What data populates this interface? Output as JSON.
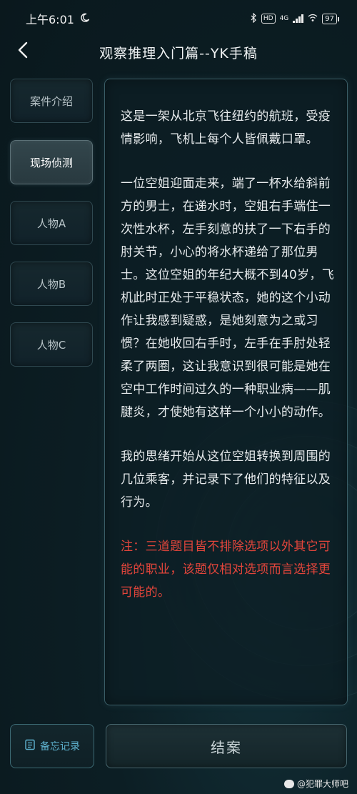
{
  "status_bar": {
    "time": "上午6:01",
    "hd_label": "HD",
    "network_label": "4G",
    "battery": "97"
  },
  "header": {
    "title": "观察推理入门篇--YK手稿"
  },
  "sidebar": {
    "items": [
      {
        "label": "案件介绍",
        "active": false
      },
      {
        "label": "现场侦测",
        "active": true
      },
      {
        "label": "人物A",
        "active": false
      },
      {
        "label": "人物B",
        "active": false
      },
      {
        "label": "人物C",
        "active": false
      }
    ]
  },
  "content": {
    "paragraphs": [
      "这是一架从北京飞往纽约的航班，受疫情影响，飞机上每个人皆佩戴口罩。",
      "一位空姐迎面走来，端了一杯水给斜前方的男士，在递水时，空姐右手端住一次性水杯，左手刻意的扶了一下右手的肘关节，小心的将水杯递给了那位男士。这位空姐的年纪大概不到40岁，飞机此时正处于平稳状态，她的这个小动作让我感到疑惑，是她刻意为之或习惯？在她收回右手时，左手在手肘处轻柔了两圈，这让我意识到很可能是她在空中工作时间过久的一种职业病——肌腱炎，才使她有这样一个小小的动作。",
      "我的思绪开始从这位空姐转换到周围的几位乘客，并记录下了他们的特征以及行为。"
    ],
    "note": "注：三道题目皆不排除选项以外其它可能的职业，该题仅相对选项而言选择更可能的。"
  },
  "bottom": {
    "memo_label": "备忘记录",
    "close_case_label": "结案"
  },
  "watermark": {
    "text": "@犯罪大师吧"
  },
  "colors": {
    "note_red": "#e2453b",
    "memo_blue": "#5fb3d0"
  }
}
